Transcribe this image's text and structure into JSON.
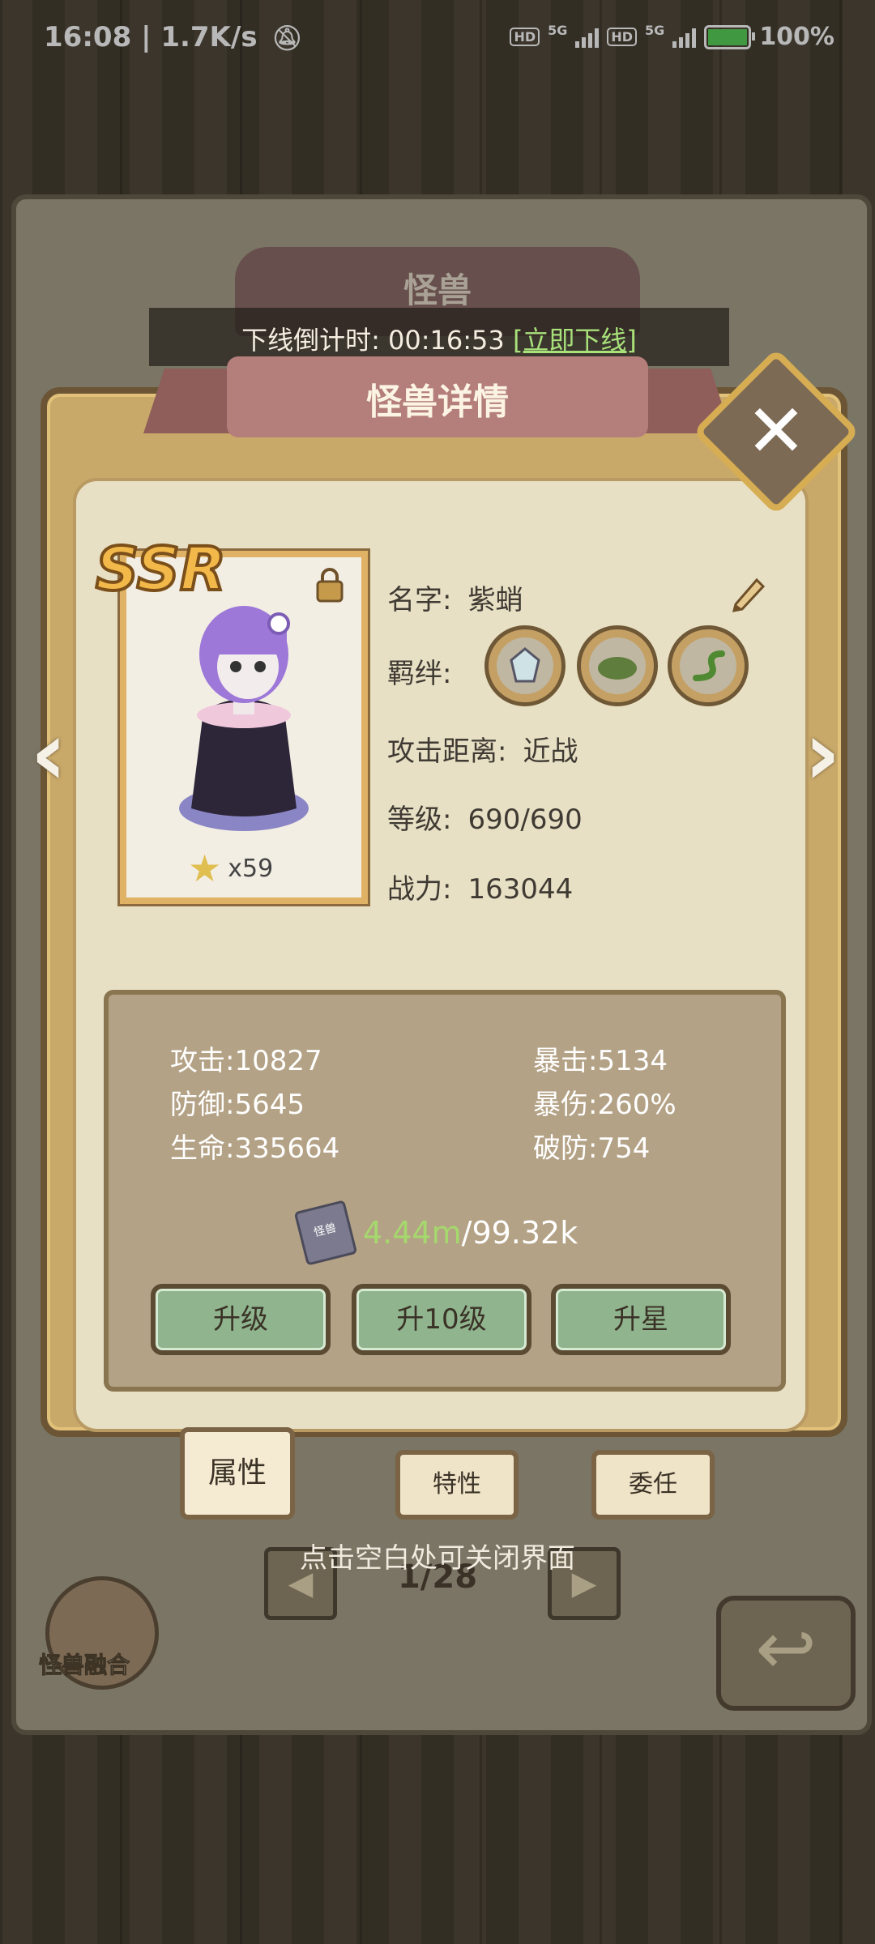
{
  "status_bar": {
    "time_speed": "16:08 | 1.7K/s",
    "hd1": "HD",
    "net1": "5G",
    "hd2": "HD",
    "net2": "5G",
    "battery": "100%",
    "battery_color": "#59d35a"
  },
  "background_screen": {
    "title": "怪兽",
    "countdown_label": "下线倒计时:",
    "countdown_time": "00:16:53",
    "offline_link": "[立即下线]"
  },
  "popup": {
    "title": "怪兽详情",
    "close_icon": "close-icon"
  },
  "card": {
    "rarity": "SSR",
    "lock_icon": "lock-icon",
    "star_count": "x59"
  },
  "info": {
    "name_label": "名字:",
    "name_value": "紫蛸",
    "bond_label": "羁绊:",
    "bond_icons": [
      "crystal-icon",
      "moss-icon",
      "serpent-icon"
    ],
    "range_label": "攻击距离:",
    "range_value": "近战",
    "level_label": "等级:",
    "level_value": "690/690",
    "power_label": "战力:",
    "power_value": "163044"
  },
  "stats": {
    "attack": "攻击:10827",
    "defense": "防御:5645",
    "hp": "生命:335664",
    "crit": "暴击:5134",
    "crit_dmg": "暴伤:260%",
    "armor_pen": "破防:754"
  },
  "exp": {
    "icon_label": "怪兽",
    "current": "4.44m",
    "required": "/99.32k",
    "current_color": "#a5d86d"
  },
  "actions": {
    "upgrade": "升级",
    "upgrade10": "升10级",
    "star_up": "升星"
  },
  "tabs": {
    "attributes": "属性",
    "traits": "特性",
    "delegate": "委任"
  },
  "hint": "点击空白处可关闭界面",
  "pagination": {
    "page": "1/28"
  },
  "fusion": {
    "label": "怪兽融合"
  }
}
